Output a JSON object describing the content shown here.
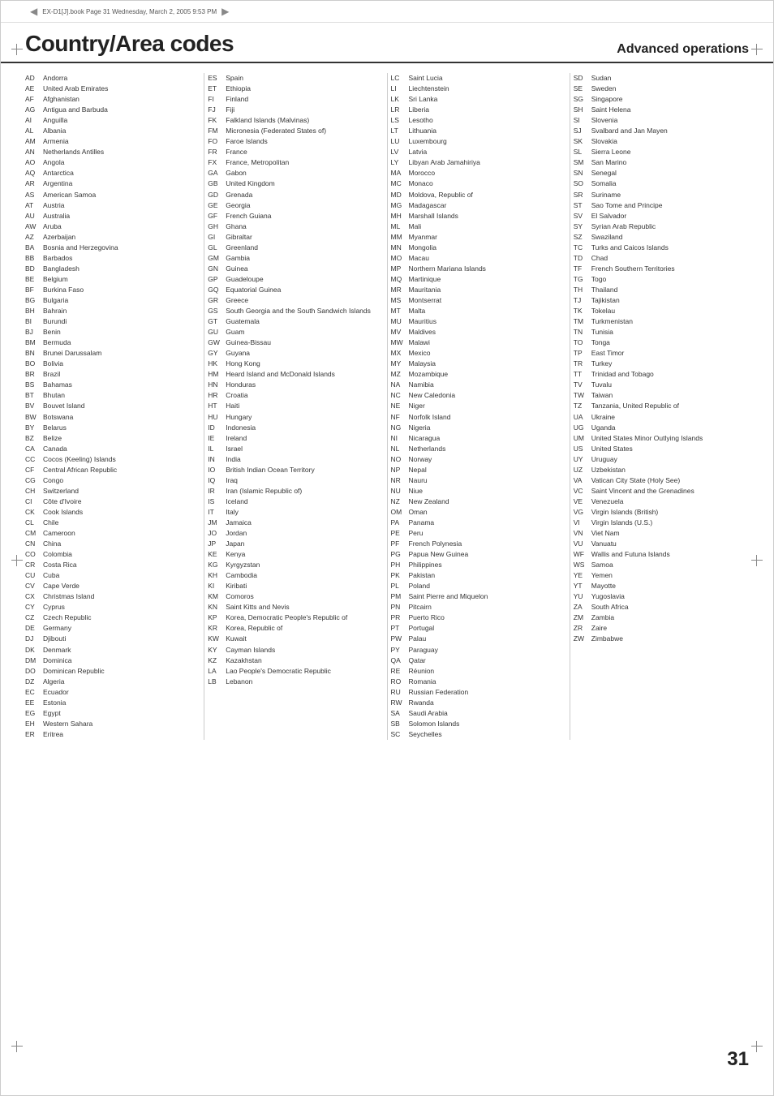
{
  "header": {
    "title": "Country/Area codes",
    "subtitle": "Advanced operations",
    "page_num": "31",
    "top_bar_text": "EX-D1[J].book  Page 31  Wednesday, March 2, 2005  9:53 PM"
  },
  "col1": [
    {
      "code": "AD",
      "name": "Andorra"
    },
    {
      "code": "AE",
      "name": "United Arab Emirates"
    },
    {
      "code": "AF",
      "name": "Afghanistan"
    },
    {
      "code": "AG",
      "name": "Antigua and Barbuda"
    },
    {
      "code": "AI",
      "name": "Anguilla"
    },
    {
      "code": "AL",
      "name": "Albania"
    },
    {
      "code": "AM",
      "name": "Armenia"
    },
    {
      "code": "AN",
      "name": "Netherlands Antilles"
    },
    {
      "code": "AO",
      "name": "Angola"
    },
    {
      "code": "AQ",
      "name": "Antarctica"
    },
    {
      "code": "AR",
      "name": "Argentina"
    },
    {
      "code": "AS",
      "name": "American Samoa"
    },
    {
      "code": "AT",
      "name": "Austria"
    },
    {
      "code": "AU",
      "name": "Australia"
    },
    {
      "code": "AW",
      "name": "Aruba"
    },
    {
      "code": "AZ",
      "name": "Azerbaijan"
    },
    {
      "code": "BA",
      "name": "Bosnia and Herzegovina"
    },
    {
      "code": "BB",
      "name": "Barbados"
    },
    {
      "code": "BD",
      "name": "Bangladesh"
    },
    {
      "code": "BE",
      "name": "Belgium"
    },
    {
      "code": "BF",
      "name": "Burkina Faso"
    },
    {
      "code": "BG",
      "name": "Bulgaria"
    },
    {
      "code": "BH",
      "name": "Bahrain"
    },
    {
      "code": "BI",
      "name": "Burundi"
    },
    {
      "code": "BJ",
      "name": "Benin"
    },
    {
      "code": "BM",
      "name": "Bermuda"
    },
    {
      "code": "BN",
      "name": "Brunei Darussalam"
    },
    {
      "code": "BO",
      "name": "Bolivia"
    },
    {
      "code": "BR",
      "name": "Brazil"
    },
    {
      "code": "BS",
      "name": "Bahamas"
    },
    {
      "code": "BT",
      "name": "Bhutan"
    },
    {
      "code": "BV",
      "name": "Bouvet Island"
    },
    {
      "code": "BW",
      "name": "Botswana"
    },
    {
      "code": "BY",
      "name": "Belarus"
    },
    {
      "code": "BZ",
      "name": "Belize"
    },
    {
      "code": "CA",
      "name": "Canada"
    },
    {
      "code": "CC",
      "name": "Cocos (Keeling) Islands"
    },
    {
      "code": "CF",
      "name": "Central African Republic"
    },
    {
      "code": "CG",
      "name": "Congo"
    },
    {
      "code": "CH",
      "name": "Switzerland"
    },
    {
      "code": "CI",
      "name": "Côte d'Ivoire"
    },
    {
      "code": "CK",
      "name": "Cook Islands"
    },
    {
      "code": "CL",
      "name": "Chile"
    },
    {
      "code": "CM",
      "name": "Cameroon"
    },
    {
      "code": "CN",
      "name": "China"
    },
    {
      "code": "CO",
      "name": "Colombia"
    },
    {
      "code": "CR",
      "name": "Costa Rica"
    },
    {
      "code": "CU",
      "name": "Cuba"
    },
    {
      "code": "CV",
      "name": "Cape Verde"
    },
    {
      "code": "CX",
      "name": "Christmas Island"
    },
    {
      "code": "CY",
      "name": "Cyprus"
    },
    {
      "code": "CZ",
      "name": "Czech Republic"
    },
    {
      "code": "DE",
      "name": "Germany"
    },
    {
      "code": "DJ",
      "name": "Djibouti"
    },
    {
      "code": "DK",
      "name": "Denmark"
    },
    {
      "code": "DM",
      "name": "Dominica"
    },
    {
      "code": "DO",
      "name": "Dominican Republic"
    },
    {
      "code": "DZ",
      "name": "Algeria"
    },
    {
      "code": "EC",
      "name": "Ecuador"
    },
    {
      "code": "EE",
      "name": "Estonia"
    },
    {
      "code": "EG",
      "name": "Egypt"
    },
    {
      "code": "EH",
      "name": "Western Sahara"
    },
    {
      "code": "ER",
      "name": "Eritrea"
    }
  ],
  "col2": [
    {
      "code": "ES",
      "name": "Spain"
    },
    {
      "code": "ET",
      "name": "Ethiopia"
    },
    {
      "code": "FI",
      "name": "Finland"
    },
    {
      "code": "FJ",
      "name": "Fiji"
    },
    {
      "code": "FK",
      "name": "Falkland Islands (Malvinas)"
    },
    {
      "code": "FM",
      "name": "Micronesia (Federated States of)"
    },
    {
      "code": "FO",
      "name": "Faroe Islands"
    },
    {
      "code": "FR",
      "name": "France"
    },
    {
      "code": "FX",
      "name": "France, Metropolitan"
    },
    {
      "code": "GA",
      "name": "Gabon"
    },
    {
      "code": "GB",
      "name": "United Kingdom"
    },
    {
      "code": "GD",
      "name": "Grenada"
    },
    {
      "code": "GE",
      "name": "Georgia"
    },
    {
      "code": "GF",
      "name": "French Guiana"
    },
    {
      "code": "GH",
      "name": "Ghana"
    },
    {
      "code": "GI",
      "name": "Gibraltar"
    },
    {
      "code": "GL",
      "name": "Greenland"
    },
    {
      "code": "GM",
      "name": "Gambia"
    },
    {
      "code": "GN",
      "name": "Guinea"
    },
    {
      "code": "GP",
      "name": "Guadeloupe"
    },
    {
      "code": "GQ",
      "name": "Equatorial Guinea"
    },
    {
      "code": "GR",
      "name": "Greece"
    },
    {
      "code": "GS",
      "name": "South Georgia and the South Sandwich Islands"
    },
    {
      "code": "GT",
      "name": "Guatemala"
    },
    {
      "code": "GU",
      "name": "Guam"
    },
    {
      "code": "GW",
      "name": "Guinea-Bissau"
    },
    {
      "code": "GY",
      "name": "Guyana"
    },
    {
      "code": "HK",
      "name": "Hong Kong"
    },
    {
      "code": "HM",
      "name": "Heard Island and McDonald Islands"
    },
    {
      "code": "HN",
      "name": "Honduras"
    },
    {
      "code": "HR",
      "name": "Croatia"
    },
    {
      "code": "HT",
      "name": "Haiti"
    },
    {
      "code": "HU",
      "name": "Hungary"
    },
    {
      "code": "ID",
      "name": "Indonesia"
    },
    {
      "code": "IE",
      "name": "Ireland"
    },
    {
      "code": "IL",
      "name": "Israel"
    },
    {
      "code": "IN",
      "name": "India"
    },
    {
      "code": "IO",
      "name": "British Indian Ocean Territory"
    },
    {
      "code": "IQ",
      "name": "Iraq"
    },
    {
      "code": "IR",
      "name": "Iran (Islamic Republic of)"
    },
    {
      "code": "IS",
      "name": "Iceland"
    },
    {
      "code": "IT",
      "name": "Italy"
    },
    {
      "code": "JM",
      "name": "Jamaica"
    },
    {
      "code": "JO",
      "name": "Jordan"
    },
    {
      "code": "JP",
      "name": "Japan"
    },
    {
      "code": "KE",
      "name": "Kenya"
    },
    {
      "code": "KG",
      "name": "Kyrgyzstan"
    },
    {
      "code": "KH",
      "name": "Cambodia"
    },
    {
      "code": "KI",
      "name": "Kiribati"
    },
    {
      "code": "KM",
      "name": "Comoros"
    },
    {
      "code": "KN",
      "name": "Saint Kitts and Nevis"
    },
    {
      "code": "KP",
      "name": "Korea, Democratic People's Republic of"
    },
    {
      "code": "KR",
      "name": "Korea, Republic of"
    },
    {
      "code": "KW",
      "name": "Kuwait"
    },
    {
      "code": "KY",
      "name": "Cayman Islands"
    },
    {
      "code": "KZ",
      "name": "Kazakhstan"
    },
    {
      "code": "LA",
      "name": "Lao People's Democratic Republic"
    },
    {
      "code": "LB",
      "name": "Lebanon"
    }
  ],
  "col3": [
    {
      "code": "LC",
      "name": "Saint Lucia"
    },
    {
      "code": "LI",
      "name": "Liechtenstein"
    },
    {
      "code": "LK",
      "name": "Sri Lanka"
    },
    {
      "code": "LR",
      "name": "Liberia"
    },
    {
      "code": "LS",
      "name": "Lesotho"
    },
    {
      "code": "LT",
      "name": "Lithuania"
    },
    {
      "code": "LU",
      "name": "Luxembourg"
    },
    {
      "code": "LV",
      "name": "Latvia"
    },
    {
      "code": "LY",
      "name": "Libyan Arab Jamahiriya"
    },
    {
      "code": "MA",
      "name": "Morocco"
    },
    {
      "code": "MC",
      "name": "Monaco"
    },
    {
      "code": "MD",
      "name": "Moldova, Republic of"
    },
    {
      "code": "MG",
      "name": "Madagascar"
    },
    {
      "code": "MH",
      "name": "Marshall Islands"
    },
    {
      "code": "ML",
      "name": "Mali"
    },
    {
      "code": "MM",
      "name": "Myanmar"
    },
    {
      "code": "MN",
      "name": "Mongolia"
    },
    {
      "code": "MO",
      "name": "Macau"
    },
    {
      "code": "MP",
      "name": "Northern Mariana Islands"
    },
    {
      "code": "MQ",
      "name": "Martinique"
    },
    {
      "code": "MR",
      "name": "Mauritania"
    },
    {
      "code": "MS",
      "name": "Montserrat"
    },
    {
      "code": "MT",
      "name": "Malta"
    },
    {
      "code": "MU",
      "name": "Mauritius"
    },
    {
      "code": "MV",
      "name": "Maldives"
    },
    {
      "code": "MW",
      "name": "Malawi"
    },
    {
      "code": "MX",
      "name": "Mexico"
    },
    {
      "code": "MY",
      "name": "Malaysia"
    },
    {
      "code": "MZ",
      "name": "Mozambique"
    },
    {
      "code": "NA",
      "name": "Namibia"
    },
    {
      "code": "NC",
      "name": "New Caledonia"
    },
    {
      "code": "NE",
      "name": "Niger"
    },
    {
      "code": "NF",
      "name": "Norfolk Island"
    },
    {
      "code": "NG",
      "name": "Nigeria"
    },
    {
      "code": "NI",
      "name": "Nicaragua"
    },
    {
      "code": "NL",
      "name": "Netherlands"
    },
    {
      "code": "NO",
      "name": "Norway"
    },
    {
      "code": "NP",
      "name": "Nepal"
    },
    {
      "code": "NR",
      "name": "Nauru"
    },
    {
      "code": "NU",
      "name": "Niue"
    },
    {
      "code": "NZ",
      "name": "New Zealand"
    },
    {
      "code": "OM",
      "name": "Oman"
    },
    {
      "code": "PA",
      "name": "Panama"
    },
    {
      "code": "PE",
      "name": "Peru"
    },
    {
      "code": "PF",
      "name": "French Polynesia"
    },
    {
      "code": "PG",
      "name": "Papua New Guinea"
    },
    {
      "code": "PH",
      "name": "Philippines"
    },
    {
      "code": "PK",
      "name": "Pakistan"
    },
    {
      "code": "PL",
      "name": "Poland"
    },
    {
      "code": "PM",
      "name": "Saint Pierre and Miquelon"
    },
    {
      "code": "PN",
      "name": "Pitcairn"
    },
    {
      "code": "PR",
      "name": "Puerto Rico"
    },
    {
      "code": "PT",
      "name": "Portugal"
    },
    {
      "code": "PW",
      "name": "Palau"
    },
    {
      "code": "PY",
      "name": "Paraguay"
    },
    {
      "code": "QA",
      "name": "Qatar"
    },
    {
      "code": "RE",
      "name": "Réunion"
    },
    {
      "code": "RO",
      "name": "Romania"
    },
    {
      "code": "RU",
      "name": "Russian Federation"
    },
    {
      "code": "RW",
      "name": "Rwanda"
    },
    {
      "code": "SA",
      "name": "Saudi Arabia"
    },
    {
      "code": "SB",
      "name": "Solomon Islands"
    },
    {
      "code": "SC",
      "name": "Seychelles"
    }
  ],
  "col4": [
    {
      "code": "SD",
      "name": "Sudan"
    },
    {
      "code": "SE",
      "name": "Sweden"
    },
    {
      "code": "SG",
      "name": "Singapore"
    },
    {
      "code": "SH",
      "name": "Saint Helena"
    },
    {
      "code": "SI",
      "name": "Slovenia"
    },
    {
      "code": "SJ",
      "name": "Svalbard and Jan Mayen"
    },
    {
      "code": "SK",
      "name": "Slovakia"
    },
    {
      "code": "SL",
      "name": "Sierra Leone"
    },
    {
      "code": "SM",
      "name": "San Marino"
    },
    {
      "code": "SN",
      "name": "Senegal"
    },
    {
      "code": "SO",
      "name": "Somalia"
    },
    {
      "code": "SR",
      "name": "Suriname"
    },
    {
      "code": "ST",
      "name": "Sao Tome and Principe"
    },
    {
      "code": "SV",
      "name": "El Salvador"
    },
    {
      "code": "SY",
      "name": "Syrian Arab Republic"
    },
    {
      "code": "SZ",
      "name": "Swaziland"
    },
    {
      "code": "TC",
      "name": "Turks and Caicos Islands"
    },
    {
      "code": "TD",
      "name": "Chad"
    },
    {
      "code": "TF",
      "name": "French Southern Territories"
    },
    {
      "code": "TG",
      "name": "Togo"
    },
    {
      "code": "TH",
      "name": "Thailand"
    },
    {
      "code": "TJ",
      "name": "Tajikistan"
    },
    {
      "code": "TK",
      "name": "Tokelau"
    },
    {
      "code": "TM",
      "name": "Turkmenistan"
    },
    {
      "code": "TN",
      "name": "Tunisia"
    },
    {
      "code": "TO",
      "name": "Tonga"
    },
    {
      "code": "TP",
      "name": "East Timor"
    },
    {
      "code": "TR",
      "name": "Turkey"
    },
    {
      "code": "TT",
      "name": "Trinidad and Tobago"
    },
    {
      "code": "TV",
      "name": "Tuvalu"
    },
    {
      "code": "TW",
      "name": "Taiwan"
    },
    {
      "code": "TZ",
      "name": "Tanzania, United Republic of"
    },
    {
      "code": "UA",
      "name": "Ukraine"
    },
    {
      "code": "UG",
      "name": "Uganda"
    },
    {
      "code": "UM",
      "name": "United States Minor Outlying Islands"
    },
    {
      "code": "US",
      "name": "United States"
    },
    {
      "code": "UY",
      "name": "Uruguay"
    },
    {
      "code": "UZ",
      "name": "Uzbekistan"
    },
    {
      "code": "VA",
      "name": "Vatican City State (Holy See)"
    },
    {
      "code": "VC",
      "name": "Saint Vincent and the Grenadines"
    },
    {
      "code": "VE",
      "name": "Venezuela"
    },
    {
      "code": "VG",
      "name": "Virgin Islands (British)"
    },
    {
      "code": "VI",
      "name": "Virgin Islands (U.S.)"
    },
    {
      "code": "VN",
      "name": "Viet Nam"
    },
    {
      "code": "VU",
      "name": "Vanuatu"
    },
    {
      "code": "WF",
      "name": "Wallis and Futuna Islands"
    },
    {
      "code": "WS",
      "name": "Samoa"
    },
    {
      "code": "YE",
      "name": "Yemen"
    },
    {
      "code": "YT",
      "name": "Mayotte"
    },
    {
      "code": "YU",
      "name": "Yugoslavia"
    },
    {
      "code": "ZA",
      "name": "South Africa"
    },
    {
      "code": "ZM",
      "name": "Zambia"
    },
    {
      "code": "ZR",
      "name": "Zaire"
    },
    {
      "code": "ZW",
      "name": "Zimbabwe"
    }
  ]
}
